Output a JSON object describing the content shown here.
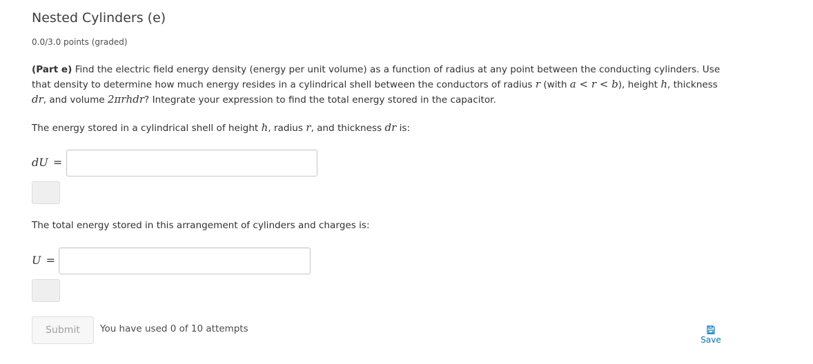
{
  "problem": {
    "title": "Nested Cylinders (e)",
    "points": "0.0/3.0 points (graded)"
  },
  "prompt": {
    "part_label": "(Part e)",
    "text_1": "Find the electric field energy density (energy per unit volume) as a function of radius at any point between the conducting cylinders. Use that density to determine how much energy resides in a cylindrical shell between the conductors of radius",
    "math_r": "r",
    "text_2": "(with",
    "math_range": "a < r < b",
    "text_3": "), height",
    "math_h": "h",
    "text_4": ", thickness",
    "math_dr": "dr",
    "text_5": ", and volume",
    "math_volume": "2πrhdr",
    "text_6": "? Integrate your expression to find the total energy stored in the capacitor."
  },
  "question_1": {
    "text_1": "The energy stored in a cylindrical shell of height",
    "math_h": "h",
    "text_2": ", radius",
    "math_r": "r",
    "text_3": ", and thickness",
    "math_dr": "dr",
    "text_4": "is:",
    "label": "dU",
    "equals": "=",
    "value": "",
    "placeholder": ""
  },
  "question_2": {
    "text": "The total energy stored in this arrangement of cylinders and charges is:",
    "label": "U",
    "equals": "=",
    "value": "",
    "placeholder": ""
  },
  "actions": {
    "submit_label": "Submit",
    "attempts_text": "You have used 0 of 10 attempts",
    "save_label": "Save",
    "save_icon": "floppy-disk-icon"
  },
  "colors": {
    "link": "#0075b4",
    "submit_disabled_text": "#a0a0a0",
    "input_border": "#c9c9c9",
    "preview_bg": "#efefef"
  }
}
